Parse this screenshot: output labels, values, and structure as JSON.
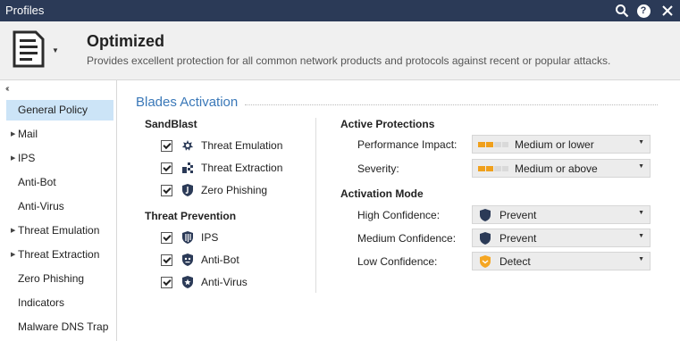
{
  "window": {
    "title": "Profiles"
  },
  "icons": {
    "search": "search-icon",
    "help": "help-icon",
    "close": "close-icon",
    "profile": "document-icon"
  },
  "header": {
    "profile_name": "Optimized",
    "description": "Provides excellent protection for all common network products and protocols against recent or popular attacks."
  },
  "sidebar": {
    "collapse_glyph": "‹‹",
    "items": [
      {
        "label": "General Policy",
        "expandable": false,
        "selected": true
      },
      {
        "label": "Mail",
        "expandable": true
      },
      {
        "label": "IPS",
        "expandable": true
      },
      {
        "label": "Anti-Bot",
        "expandable": false
      },
      {
        "label": "Anti-Virus",
        "expandable": false
      },
      {
        "label": "Threat Emulation",
        "expandable": true
      },
      {
        "label": "Threat Extraction",
        "expandable": true
      },
      {
        "label": "Zero Phishing",
        "expandable": false
      },
      {
        "label": "Indicators",
        "expandable": false
      },
      {
        "label": "Malware DNS Trap",
        "expandable": false
      }
    ]
  },
  "main": {
    "section_title": "Blades Activation",
    "sandblast": {
      "title": "SandBlast",
      "items": [
        {
          "label": "Threat Emulation",
          "checked": true,
          "icon": "threat-emulation-icon"
        },
        {
          "label": "Threat Extraction",
          "checked": true,
          "icon": "threat-extraction-icon"
        },
        {
          "label": "Zero Phishing",
          "checked": true,
          "icon": "zero-phishing-icon"
        }
      ]
    },
    "threat_prevention": {
      "title": "Threat Prevention",
      "items": [
        {
          "label": "IPS",
          "checked": true,
          "icon": "ips-icon"
        },
        {
          "label": "Anti-Bot",
          "checked": true,
          "icon": "anti-bot-icon"
        },
        {
          "label": "Anti-Virus",
          "checked": true,
          "icon": "anti-virus-icon"
        }
      ]
    },
    "active_protections": {
      "title": "Active Protections",
      "fields": [
        {
          "label": "Performance Impact:",
          "value": "Medium or lower",
          "level_segments": 2,
          "total_segments": 4
        },
        {
          "label": "Severity:",
          "value": "Medium or above",
          "level_segments": 2,
          "total_segments": 4
        }
      ]
    },
    "activation_mode": {
      "title": "Activation Mode",
      "fields": [
        {
          "label": "High Confidence:",
          "value": "Prevent",
          "icon": "prevent-shield-icon"
        },
        {
          "label": "Medium Confidence:",
          "value": "Prevent",
          "icon": "prevent-shield-icon"
        },
        {
          "label": "Low Confidence:",
          "value": "Detect",
          "icon": "detect-shield-icon"
        }
      ]
    }
  },
  "colors": {
    "titlebar": "#2b3a57",
    "accent_blue": "#3a78b8",
    "selected_bg": "#cce4f7",
    "level_on": "#f0a01c",
    "level_off": "#d9d9d9",
    "detect": "#f5a623",
    "prevent": "#2b3a57"
  }
}
